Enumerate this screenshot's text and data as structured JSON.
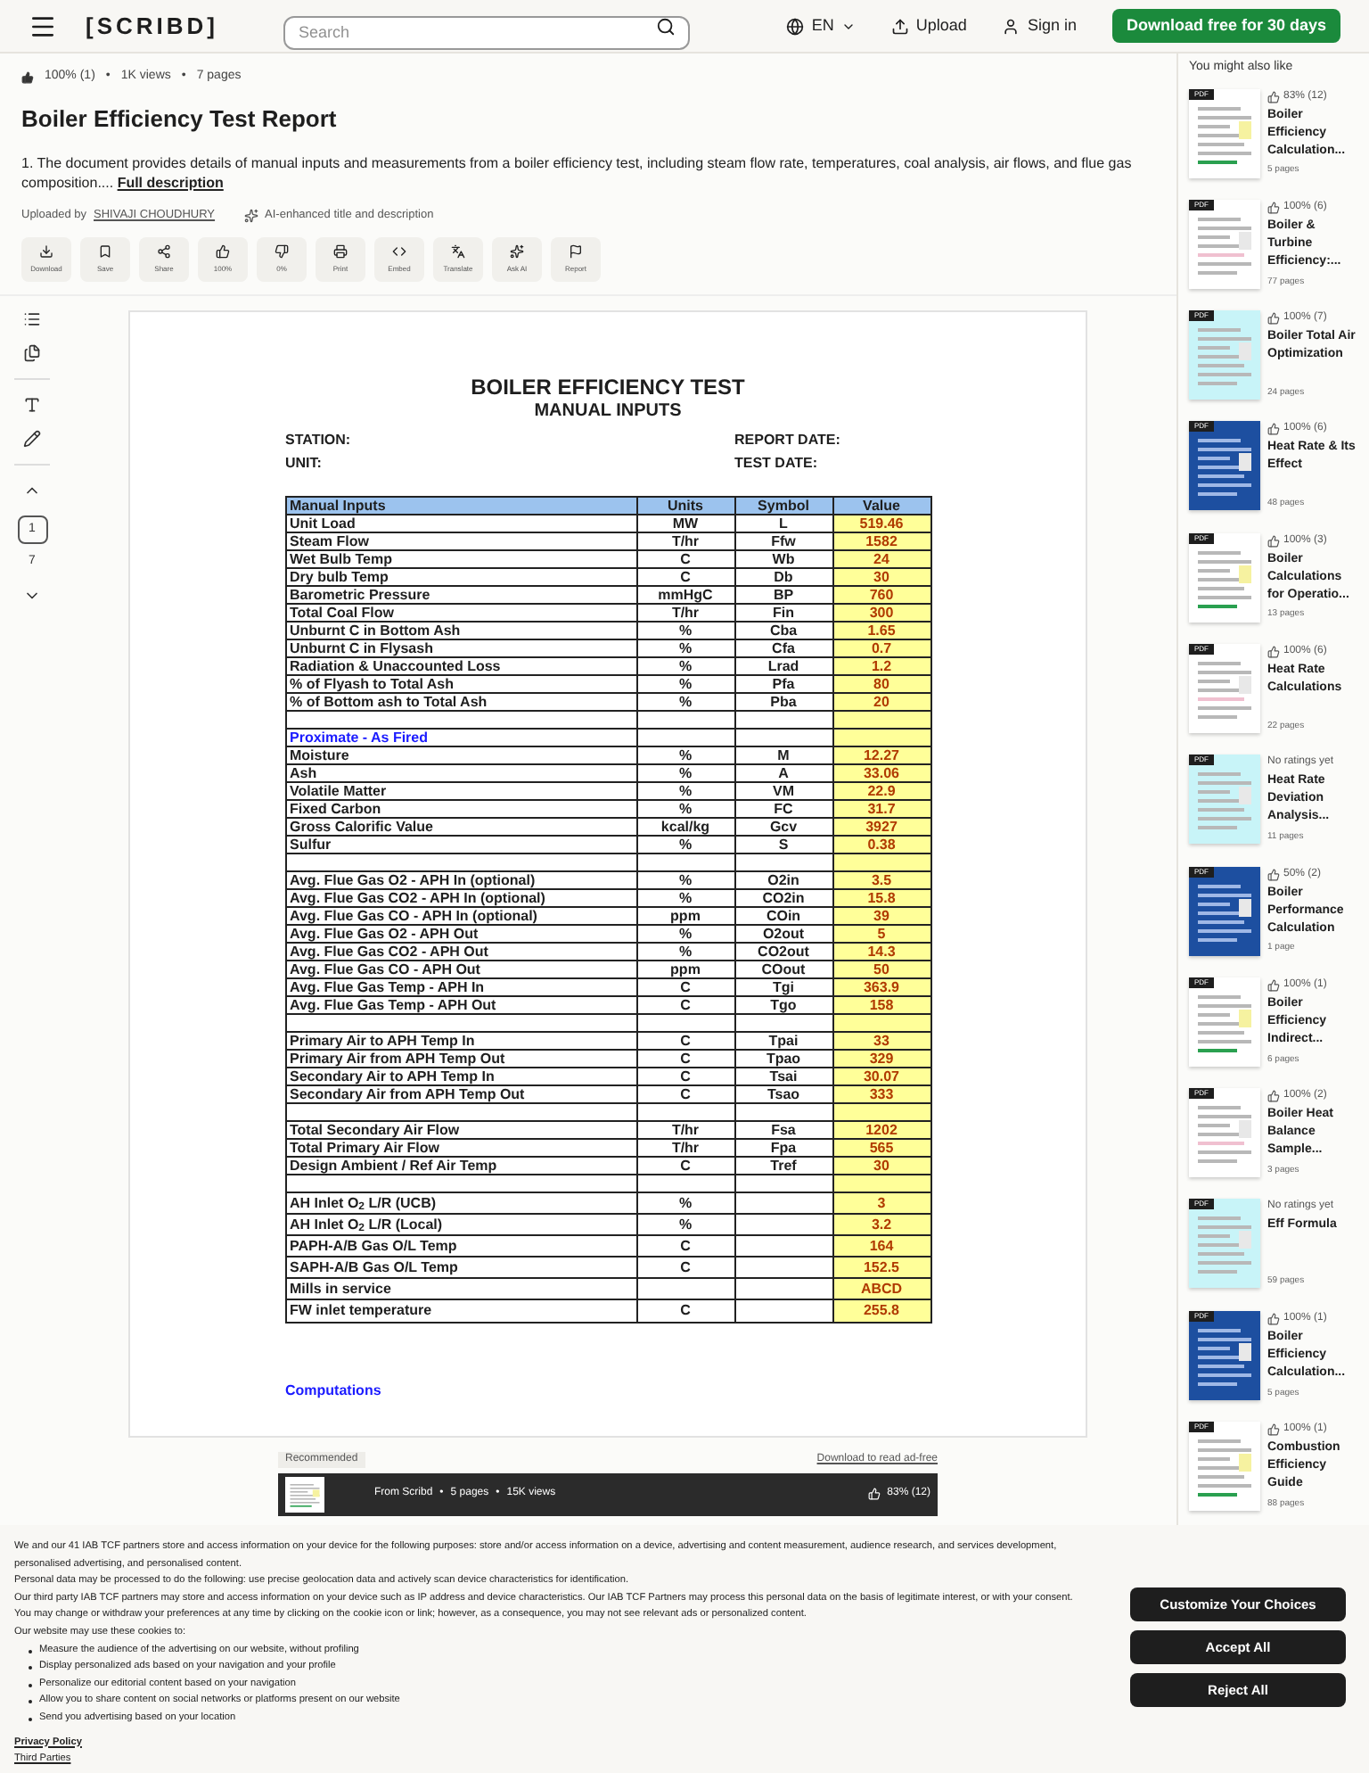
{
  "header": {
    "logo": "[SCRIBD]",
    "search_placeholder": "Search",
    "language": "EN",
    "upload": "Upload",
    "sign_in": "Sign in",
    "cta": "Download free for 30 days"
  },
  "doc": {
    "separator": "•",
    "rating": "100% (1)",
    "views": "1K views",
    "pages": "7 pages",
    "title": "Boiler Efficiency Test Report",
    "description": "1. The document provides details of manual inputs and measurements from a boiler efficiency test, including steam flow rate, temperatures, coal analysis, air flows, and flue gas composition....",
    "full_description_link": "Full description",
    "uploaded_by_label": "Uploaded by",
    "uploader": "SHIVAJI CHOUDHURY",
    "ai_note": "AI-enhanced title and description"
  },
  "actions": [
    {
      "kind": "download",
      "label": "Download"
    },
    {
      "kind": "save",
      "label": "Save"
    },
    {
      "kind": "share",
      "label": "Share"
    },
    {
      "kind": "like",
      "label": "100%"
    },
    {
      "kind": "dislike",
      "label": "0%"
    },
    {
      "kind": "print",
      "label": "Print"
    },
    {
      "kind": "embed",
      "label": "Embed"
    },
    {
      "kind": "translate",
      "label": "Translate"
    },
    {
      "kind": "ai",
      "label": "Ask AI"
    },
    {
      "kind": "report",
      "label": "Report"
    }
  ],
  "left_rail": {
    "current_page": "1",
    "total_pages": "7"
  },
  "page": {
    "heading": "BOILER EFFICIENCY TEST",
    "subheading": "MANUAL INPUTS",
    "fields": [
      "STATION:",
      "REPORT DATE:",
      "UNIT:",
      "TEST DATE:"
    ],
    "table": {
      "columns": [
        "Manual Inputs",
        "Units",
        "Symbol",
        "Value"
      ],
      "rows": [
        {
          "kind": "data",
          "cells": [
            "Unit Load",
            "MW",
            "L",
            "519.46"
          ]
        },
        {
          "kind": "data",
          "cells": [
            "Steam Flow",
            "T/hr",
            "Ffw",
            "1582"
          ]
        },
        {
          "kind": "data",
          "cells": [
            "Wet Bulb Temp",
            "C",
            "Wb",
            "24"
          ]
        },
        {
          "kind": "data",
          "cells": [
            "Dry bulb Temp",
            "C",
            "Db",
            "30"
          ]
        },
        {
          "kind": "data",
          "cells": [
            "Barometric Pressure",
            "mmHgC",
            "BP",
            "760"
          ]
        },
        {
          "kind": "data",
          "cells": [
            "Total Coal Flow",
            "T/hr",
            "Fin",
            "300"
          ]
        },
        {
          "kind": "data",
          "cells": [
            "Unburnt C in Bottom Ash",
            "%",
            "Cba",
            "1.65"
          ]
        },
        {
          "kind": "data",
          "cells": [
            "Unburnt C in Flysash",
            "%",
            "Cfa",
            "0.7"
          ]
        },
        {
          "kind": "data",
          "cells": [
            "Radiation & Unaccounted Loss",
            "%",
            "Lrad",
            "1.2"
          ]
        },
        {
          "kind": "data",
          "cells": [
            "% of Flyash to Total Ash",
            "%",
            "Pfa",
            "80"
          ]
        },
        {
          "kind": "data",
          "cells": [
            "% of Bottom ash to Total Ash",
            "%",
            "Pba",
            "20"
          ]
        },
        {
          "kind": "blank"
        },
        {
          "kind": "section",
          "cells": [
            "Proximate - As Fired"
          ]
        },
        {
          "kind": "data",
          "cells": [
            "Moisture",
            "%",
            "M",
            "12.27"
          ]
        },
        {
          "kind": "data",
          "cells": [
            "Ash",
            "%",
            "A",
            "33.06"
          ]
        },
        {
          "kind": "data",
          "cells": [
            "Volatile Matter",
            "%",
            "VM",
            "22.9"
          ]
        },
        {
          "kind": "data",
          "cells": [
            "Fixed Carbon",
            "%",
            "FC",
            "31.7"
          ]
        },
        {
          "kind": "data",
          "cells": [
            "Gross Calorific Value",
            "kcal/kg",
            "Gcv",
            "3927"
          ]
        },
        {
          "kind": "data",
          "cells": [
            "Sulfur",
            "%",
            "S",
            "0.38"
          ]
        },
        {
          "kind": "blank"
        },
        {
          "kind": "data",
          "cells": [
            "Avg. Flue Gas O2 - APH In (optional)",
            "%",
            "O2in",
            "3.5"
          ]
        },
        {
          "kind": "data",
          "cells": [
            "Avg. Flue Gas CO2 - APH In (optional)",
            "%",
            "CO2in",
            "15.8"
          ]
        },
        {
          "kind": "data",
          "cells": [
            "Avg. Flue Gas CO - APH In (optional)",
            "ppm",
            "COin",
            "39"
          ]
        },
        {
          "kind": "data",
          "cells": [
            "Avg. Flue Gas O2 - APH Out",
            "%",
            "O2out",
            "5"
          ]
        },
        {
          "kind": "data",
          "cells": [
            "Avg. Flue Gas CO2 - APH Out",
            "%",
            "CO2out",
            "14.3"
          ]
        },
        {
          "kind": "data",
          "cells": [
            "Avg. Flue Gas CO - APH Out",
            "ppm",
            "COout",
            "50"
          ]
        },
        {
          "kind": "data",
          "cells": [
            "Avg. Flue Gas Temp - APH In",
            "C",
            "Tgi",
            "363.9"
          ]
        },
        {
          "kind": "data",
          "cells": [
            "Avg. Flue Gas Temp - APH Out",
            "C",
            "Tgo",
            "158"
          ]
        },
        {
          "kind": "blank"
        },
        {
          "kind": "data",
          "cells": [
            "Primary Air to APH Temp In",
            "C",
            "Tpai",
            "33"
          ]
        },
        {
          "kind": "data",
          "cells": [
            "Primary Air from APH Temp Out",
            "C",
            "Tpao",
            "329"
          ]
        },
        {
          "kind": "data",
          "cells": [
            "Secondary Air to APH Temp In",
            "C",
            "Tsai",
            "30.07"
          ]
        },
        {
          "kind": "data",
          "cells": [
            "Secondary Air from APH Temp Out",
            "C",
            "Tsao",
            "333"
          ]
        },
        {
          "kind": "blank"
        },
        {
          "kind": "data",
          "cells": [
            "Total Secondary Air Flow",
            "T/hr",
            "Fsa",
            "1202"
          ]
        },
        {
          "kind": "data",
          "cells": [
            "Total Primary Air Flow",
            "T/hr",
            "Fpa",
            "565"
          ]
        },
        {
          "kind": "data",
          "cells": [
            "Design Ambient / Ref Air Temp",
            "C",
            "Tref",
            "30"
          ]
        },
        {
          "kind": "blank"
        },
        {
          "kind": "tall",
          "cells": [
            "AH Inlet O$_{2}$ L/R (UCB)",
            "%",
            "",
            "3"
          ]
        },
        {
          "kind": "tall",
          "cells": [
            "AH Inlet O$_{2}$ L/R (Local)",
            "%",
            "",
            "3.2"
          ]
        },
        {
          "kind": "tall",
          "cells": [
            "PAPH-A/B Gas O/L Temp",
            "C",
            "",
            "164"
          ]
        },
        {
          "kind": "tall",
          "cells": [
            "SAPH-A/B Gas O/L Temp",
            "C",
            "",
            "152.5"
          ]
        },
        {
          "kind": "tall",
          "cells": [
            "Mills in service",
            "",
            "",
            "ABCD"
          ]
        },
        {
          "kind": "tall",
          "cells": [
            "FW inlet temperature",
            "C",
            "",
            "255.8"
          ]
        }
      ]
    },
    "footer_link": "Computations"
  },
  "recommended": {
    "separator": "•",
    "label": "Recommended",
    "link": "Download to read ad-free",
    "source": "From Scribd",
    "pages": "5 pages",
    "views": "15K views",
    "rating": "83% (12)"
  },
  "sidebar": {
    "title": "You might also like",
    "items": [
      {
        "badge": "PDF",
        "rated": true,
        "rating": "83% (12)",
        "title": "Boiler Efficiency Calculation...",
        "pages": "5 pages"
      },
      {
        "badge": "PDF",
        "rated": true,
        "rating": "100% (6)",
        "title": "Boiler & Turbine Efficiency:...",
        "pages": "77 pages"
      },
      {
        "badge": "PDF",
        "rated": true,
        "rating": "100% (7)",
        "title": "Boiler Total Air Optimization",
        "pages": "24 pages"
      },
      {
        "badge": "PDF",
        "rated": true,
        "rating": "100% (6)",
        "title": "Heat Rate & Its Effect",
        "pages": "48 pages"
      },
      {
        "badge": "PDF",
        "rated": true,
        "rating": "100% (3)",
        "title": "Boiler Calculations for Operatio...",
        "pages": "13 pages"
      },
      {
        "badge": "PDF",
        "rated": true,
        "rating": "100% (6)",
        "title": "Heat Rate Calculations",
        "pages": "22 pages"
      },
      {
        "badge": "PDF",
        "rated": false,
        "rating": "No ratings yet",
        "title": "Heat Rate Deviation Analysis...",
        "pages": "11 pages"
      },
      {
        "badge": "PDF",
        "rated": true,
        "rating": "50% (2)",
        "title": "Boiler Performance Calculation",
        "pages": "1 page"
      },
      {
        "badge": "PDF",
        "rated": true,
        "rating": "100% (1)",
        "title": "Boiler Efficiency Indirect...",
        "pages": "6 pages"
      },
      {
        "badge": "PDF",
        "rated": true,
        "rating": "100% (2)",
        "title": "Boiler Heat Balance Sample...",
        "pages": "3 pages"
      },
      {
        "badge": "PDF",
        "rated": false,
        "rating": "No ratings yet",
        "title": "Eff Formula",
        "pages": "59 pages"
      },
      {
        "badge": "PDF",
        "rated": true,
        "rating": "100% (1)",
        "title": "Boiler Efficiency Calculation...",
        "pages": "5 pages"
      },
      {
        "badge": "PDF",
        "rated": true,
        "rating": "100% (1)",
        "title": "Combustion Efficiency Guide",
        "pages": "88 pages"
      }
    ]
  },
  "cookie": {
    "paragraphs": [
      "We and our 41 IAB TCF partners store and access information on your device for the following purposes: store and/or access information on a device, advertising and content measurement, audience research, and services development, personalised advertising, and personalised content.",
      "Personal data may be processed to do the following: use precise geolocation data and actively scan device characteristics for identification.",
      "Our third party IAB TCF partners may store and access information on your device such as IP address and device characteristics. Our IAB TCF Partners may process this personal data on the basis of legitimate interest, or with your consent. You may change or withdraw your preferences at any time by clicking on the cookie icon or link; however, as a consequence, you may not see relevant ads or personalized content.",
      "Our website may use these cookies to:"
    ],
    "bullets": [
      "Measure the audience of the advertising on our website, without profiling",
      "Display personalized ads based on your navigation and your profile",
      "Personalize our editorial content based on your navigation",
      "Allow you to share content on social networks or platforms present on our website",
      "Send you advertising based on your location"
    ],
    "links": [
      "Privacy Policy",
      "Third Parties"
    ],
    "buttons": [
      "Customize Your Choices",
      "Accept All",
      "Reject All"
    ]
  }
}
